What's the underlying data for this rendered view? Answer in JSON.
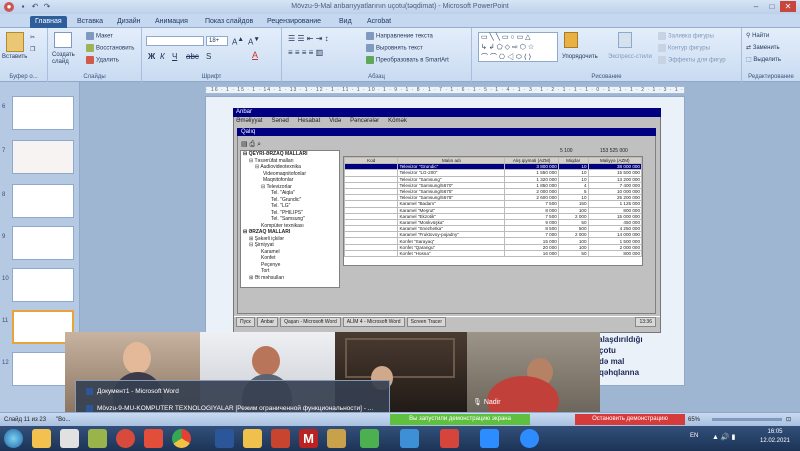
{
  "window": {
    "title": "Mövzu-9-Mal anbarıyyatlarının uçotu(təqdimat) - Microsoft PowerPoint"
  },
  "ribbon_tabs": [
    "Главная",
    "Вставка",
    "Дизайн",
    "Анимация",
    "Показ слайдов",
    "Рецензирование",
    "Вид",
    "Acrobat"
  ],
  "ribbon": {
    "clipboard": {
      "paste": "Вставить",
      "label": "Буфер о..."
    },
    "slides": {
      "create": "Создать слайд",
      "layout": "Макет",
      "reset": "Восстановить",
      "delete": "Удалить",
      "label": "Слайды"
    },
    "font": {
      "label": "Шрифт",
      "size": "18+"
    },
    "paragraph": {
      "direction": "Направление текста",
      "align": "Выровнять текст",
      "smartart": "Преобразовать в SmartArt",
      "label": "Абзац"
    },
    "drawing": {
      "arrange": "Упорядочить",
      "quick": "Экспресс-стили",
      "fill": "Заливка фигуры",
      "outline": "Контур фигуры",
      "effects": "Эффекты для фигур",
      "label": "Рисование"
    },
    "editing": {
      "find": "Найти",
      "replace": "Заменить",
      "select": "Выделить",
      "label": "Редактирование"
    }
  },
  "ruler": "· 16 · 1 · 15 · 1 · 14 · 1 · 13 · 1 · 12 · 1 · 11 · 1 · 10 · 1 · 9 · 1 · 8 · 1 · 7 · 1 · 6 · 1 · 5 · 1 · 4 · 1 · 3 · 1 · 2 · 1 · 1 · 1 · 0 · 1 · 1 · 1 · 2 · 1 · 3 · 1 · 4 · 1 · 5 · 1 · 6 · 1 · 7 · 1 · 8 · 1 · 9 · 1 · 10 · 1 · 11 · 1 · 12 · 1 · 13 · 1 · 14 · 1 · 15 · 1 · 16",
  "slide_numbers": [
    "6",
    "7",
    "8",
    "9",
    "10",
    "11",
    "12"
  ],
  "app": {
    "title": "Anbar",
    "menu": [
      "Əməliyyat",
      "Sənəd",
      "Hesabat",
      "Vidə",
      "Pəncərələr",
      "Kömək"
    ],
    "inner_title": "Qalıq",
    "tree": [
      "QEYRİ-ƏRZAQ MALLARI",
      "Təsərrüfat malları",
      "Audiovideotexnika",
      "Videomaqnitofonlar",
      "Maqnitofonlar",
      "Televizorlar",
      "Tel. \"Aiqla\"",
      "Tel. \"Grundic\"",
      "Tel. \"LG\"",
      "Tel. \"PHILIPS\"",
      "Tel. \"Samsung\"",
      "Kompüter texnikası",
      "ƏRZAQ MALLARI",
      "Şəkərli içkilər",
      "Şirniyyat",
      "Karamel",
      "Konfet",
      "Peçenye",
      "Tort",
      "Ət məhsulları"
    ],
    "totals": [
      "5 100",
      "153 525 000"
    ],
    "columns": [
      "Kod",
      "Malın adı",
      "Alış qiyməti (AZM)",
      "Miqdar",
      "Maliyyə (AZM)"
    ],
    "rows": [
      [
        "",
        "Televizor \"Grundic\"",
        "3 800 000",
        "10",
        "38 000 000"
      ],
      [
        "",
        "Televizor \"LG-200\"",
        "1 550 000",
        "10",
        "15 500 000"
      ],
      [
        "",
        "Televizor \"Samsung\"",
        "1 320 000",
        "10",
        "13 200 000"
      ],
      [
        "",
        "Televizor \"Samsung/5670\"",
        "1 850 000",
        "4",
        "7 400 000"
      ],
      [
        "",
        "Televizor \"Samsung/5675\"",
        "2 000 000",
        "5",
        "10 000 000"
      ],
      [
        "",
        "Televizor \"Samsung/5678\"",
        "2 600 000",
        "10",
        "25 200 000"
      ],
      [
        "",
        "Karamel \"Badam\"",
        "7 500",
        "150",
        "1 125 000"
      ],
      [
        "",
        "Karamel \"Meşrut\"",
        "8 000",
        "100",
        "800 000"
      ],
      [
        "",
        "Karamel \"Ekzotik\"",
        "7 500",
        "2 000",
        "15 000 000"
      ],
      [
        "",
        "Karamel \"Moskvüşka\"",
        "9 000",
        "50",
        "450 000"
      ],
      [
        "",
        "Karamel \"Snezhetka\"",
        "8 500",
        "500",
        "4 250 000"
      ],
      [
        "",
        "Karamel \"Fruktovoy-pojadny\"",
        "7 000",
        "2 000",
        "14 000 000"
      ],
      [
        "",
        "Konfet \"Sarayaq\"",
        "15 000",
        "100",
        "1 500 000"
      ],
      [
        "",
        "Konfet \"Qarangu\"",
        "20 000",
        "100",
        "2 000 000"
      ],
      [
        "",
        "Konfet \"Hosna\"",
        "16 000",
        "50",
        "800 000"
      ]
    ],
    "status": [
      "Пуск",
      "Anbar",
      "Qaşan - Microsoft Word",
      "ALİM 4 - Microsoft Word",
      "Screen Tracer",
      "13:36"
    ]
  },
  "slide_text": [
    "ormalaşdırıldığı",
    "və uçotu",
    "əsində mal",
    "mal qəhqlanna"
  ],
  "video": {
    "participant": "Nadir"
  },
  "popup": {
    "items": [
      "Документ1 - Microsoft Word",
      "Mövzu-9-MU-KOMPUTER TEXNOLOGIYALAR [Режим ограниченной функциональности] - ..."
    ]
  },
  "statusbar": {
    "slide": "Слайд 11 из 23",
    "theme": "\"Во...",
    "zoom": "65%"
  },
  "demo": {
    "show": "Вы запустили демонстрацию экрана",
    "stop": "Остановить демонстрацию"
  },
  "taskbar": {
    "lang": "EN",
    "time": "16:05",
    "date": "12.02.2021"
  }
}
